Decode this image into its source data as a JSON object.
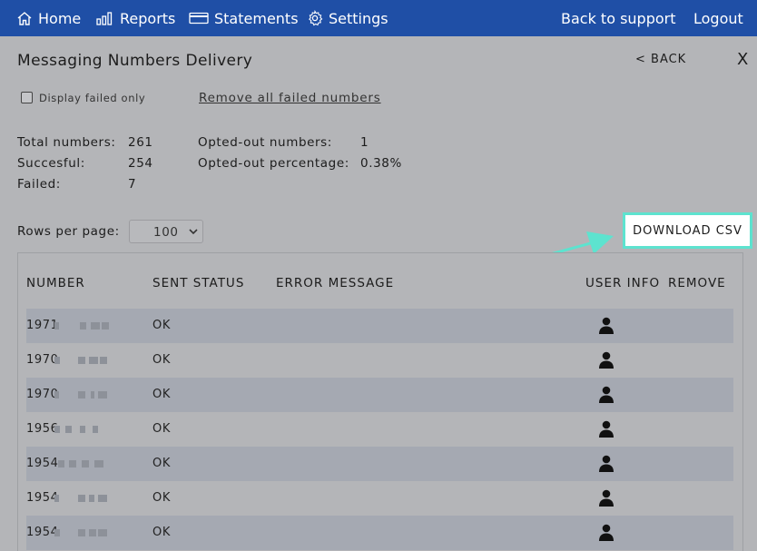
{
  "nav": {
    "home": "Home",
    "reports": "Reports",
    "statements": "Statements",
    "settings": "Settings",
    "support": "Back to support",
    "logout": "Logout"
  },
  "page": {
    "title": "Messaging Numbers Delivery",
    "back": "< BACK",
    "close": "X"
  },
  "filters": {
    "display_failed_only": "Display failed only",
    "display_failed_checked": false,
    "remove_failed": "Remove all failed numbers"
  },
  "stats": {
    "total_label": "Total numbers:",
    "total_value": "261",
    "success_label": "Succesful:",
    "success_value": "254",
    "failed_label": "Failed:",
    "failed_value": "7",
    "optout_label": "Opted-out numbers:",
    "optout_value": "1",
    "optout_pct_label": "Opted-out percentage:",
    "optout_pct_value": "0.38%"
  },
  "pagination": {
    "rows_label": "Rows per page:",
    "rows_value": "100"
  },
  "download_csv": "DOWNLOAD CSV",
  "table": {
    "headers": {
      "number": "NUMBER",
      "sent_status": "SENT STATUS",
      "error_message": "ERROR MESSAGE",
      "user_info": "USER INFO",
      "remove": "REMOVE"
    },
    "rows": [
      {
        "number": "1971",
        "status": "OK"
      },
      {
        "number": "1970",
        "status": "OK"
      },
      {
        "number": "1970",
        "status": "OK"
      },
      {
        "number": "1956",
        "status": "OK"
      },
      {
        "number": "1954",
        "status": "OK"
      },
      {
        "number": "1954",
        "status": "OK"
      },
      {
        "number": "1954",
        "status": "OK"
      }
    ]
  },
  "colors": {
    "nav_bg": "#1f4fa6",
    "highlight": "#5de3cf",
    "overlay_bg": "#b4b5b8",
    "row_alt": "#a5a9b2"
  }
}
